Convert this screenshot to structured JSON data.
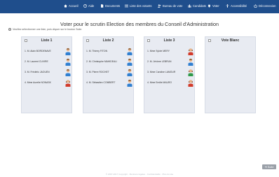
{
  "nav": {
    "accueil": "Accueil",
    "aide": "Aide",
    "documents": "Documents",
    "liste_votants": "Liste des votants",
    "bureau": "Bureau de vote",
    "candidats": "Candidats",
    "voter": "Voter",
    "accessibilite": "Accessibilité",
    "deconnexion": "Déconnexion"
  },
  "page": {
    "title": "Voter pour le scrutin Election des membres du Conseil d'Administration",
    "instruction": "Veuillez sélectionner une liste, puis cliquer sur le bouton Suite."
  },
  "lists": [
    {
      "name": "Liste 1",
      "candidates": [
        {
          "name": "1. M. Alain BORDENAVE",
          "gender": "m"
        },
        {
          "name": "2. M. Laurent CUVIRE",
          "gender": "m"
        },
        {
          "name": "3. M. Frédéric JAOUEN",
          "gender": "m"
        },
        {
          "name": "4. Mme Aurelie NONASK",
          "gender": "f"
        }
      ]
    },
    {
      "name": "Liste 2",
      "candidates": [
        {
          "name": "1. M. Thierry FITON",
          "gender": "m"
        },
        {
          "name": "2. M. Christophe MAHIDEAU",
          "gender": "m"
        },
        {
          "name": "3. M. Pierre ROCHET",
          "gender": "m"
        },
        {
          "name": "4. M. Sébastien COMBERT",
          "gender": "m"
        }
      ]
    },
    {
      "name": "Liste 3",
      "candidates": [
        {
          "name": "1. Mme Sylvie MERY",
          "gender": "f"
        },
        {
          "name": "2. M. Jérôme LEBRUN",
          "gender": "m"
        },
        {
          "name": "3. Mme Caroline LAMOUR",
          "gender": "f"
        },
        {
          "name": "4. Mme Emilie MAURO",
          "gender": "f"
        }
      ]
    },
    {
      "name": "Vote Blanc",
      "candidates": []
    }
  ],
  "buttons": {
    "suite": "➜ Suite"
  },
  "footer": "© 2007-2017 Copyright · Mentions légales · Confidentialité · Plan du site",
  "colors": {
    "topbar": "#1f4e8c",
    "list_bg": "#e8ebf2",
    "button": "#9aa0a8"
  }
}
